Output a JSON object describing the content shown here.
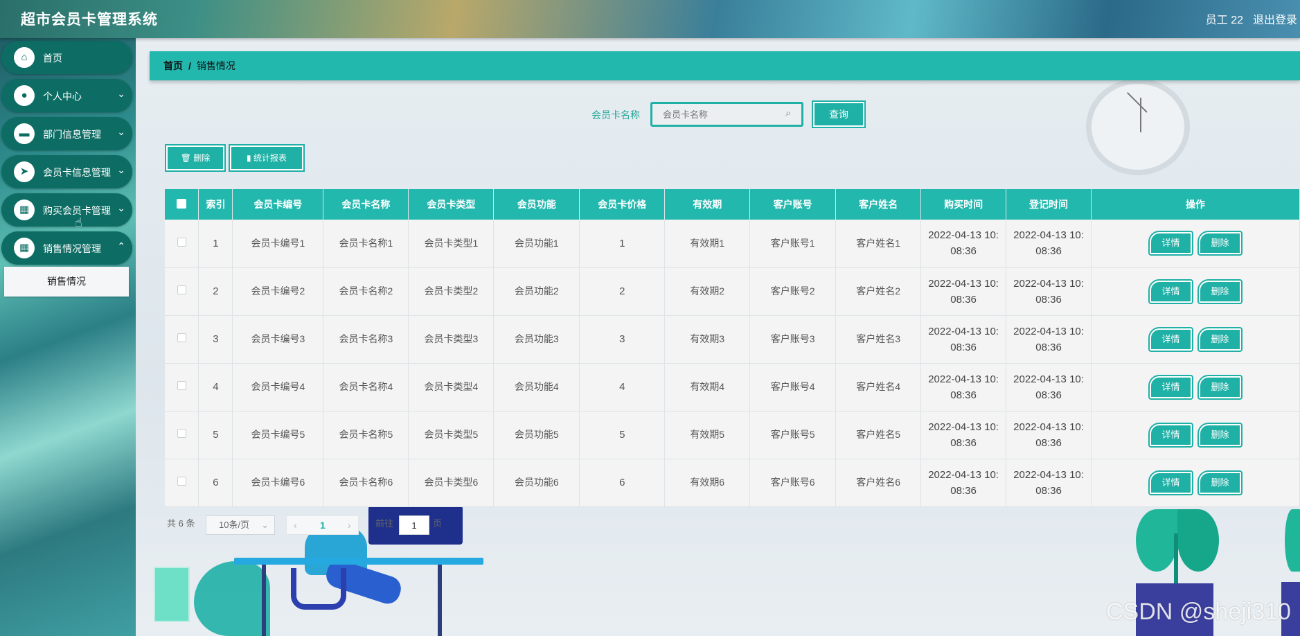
{
  "header": {
    "title": "超市会员卡管理系统",
    "user": "员工 22",
    "logout": "退出登录"
  },
  "sidebar": {
    "items": [
      {
        "label": "首页",
        "icon": "home-icon"
      },
      {
        "label": "个人中心",
        "icon": "user-icon"
      },
      {
        "label": "部门信息管理",
        "icon": "department-icon"
      },
      {
        "label": "会员卡信息管理",
        "icon": "send-icon"
      },
      {
        "label": "购买会员卡管理",
        "icon": "grid-icon"
      },
      {
        "label": "销售情况管理",
        "icon": "grid-icon"
      }
    ],
    "submenu": "销售情况"
  },
  "breadcrumb": {
    "home": "首页",
    "sep": "/",
    "current": "销售情况"
  },
  "search": {
    "label": "会员卡名称",
    "placeholder": "会员卡名称",
    "button": "查询"
  },
  "toolbar": {
    "delete": "删除",
    "report": "统计报表"
  },
  "table": {
    "headers": [
      "索引",
      "会员卡编号",
      "会员卡名称",
      "会员卡类型",
      "会员功能",
      "会员卡价格",
      "有效期",
      "客户账号",
      "客户姓名",
      "购买时间",
      "登记时间",
      "操作"
    ],
    "rows": [
      {
        "idx": "1",
        "no": "会员卡编号1",
        "name": "会员卡名称1",
        "type": "会员卡类型1",
        "func": "会员功能1",
        "price": "1",
        "valid": "有效期1",
        "account": "客户账号1",
        "cname": "客户姓名1",
        "buy_a": "2022-04-13 10:",
        "buy_b": "08:36",
        "reg_a": "2022-04-13 10:",
        "reg_b": "08:36"
      },
      {
        "idx": "2",
        "no": "会员卡编号2",
        "name": "会员卡名称2",
        "type": "会员卡类型2",
        "func": "会员功能2",
        "price": "2",
        "valid": "有效期2",
        "account": "客户账号2",
        "cname": "客户姓名2",
        "buy_a": "2022-04-13 10:",
        "buy_b": "08:36",
        "reg_a": "2022-04-13 10:",
        "reg_b": "08:36"
      },
      {
        "idx": "3",
        "no": "会员卡编号3",
        "name": "会员卡名称3",
        "type": "会员卡类型3",
        "func": "会员功能3",
        "price": "3",
        "valid": "有效期3",
        "account": "客户账号3",
        "cname": "客户姓名3",
        "buy_a": "2022-04-13 10:",
        "buy_b": "08:36",
        "reg_a": "2022-04-13 10:",
        "reg_b": "08:36"
      },
      {
        "idx": "4",
        "no": "会员卡编号4",
        "name": "会员卡名称4",
        "type": "会员卡类型4",
        "func": "会员功能4",
        "price": "4",
        "valid": "有效期4",
        "account": "客户账号4",
        "cname": "客户姓名4",
        "buy_a": "2022-04-13 10:",
        "buy_b": "08:36",
        "reg_a": "2022-04-13 10:",
        "reg_b": "08:36"
      },
      {
        "idx": "5",
        "no": "会员卡编号5",
        "name": "会员卡名称5",
        "type": "会员卡类型5",
        "func": "会员功能5",
        "price": "5",
        "valid": "有效期5",
        "account": "客户账号5",
        "cname": "客户姓名5",
        "buy_a": "2022-04-13 10:",
        "buy_b": "08:36",
        "reg_a": "2022-04-13 10:",
        "reg_b": "08:36"
      },
      {
        "idx": "6",
        "no": "会员卡编号6",
        "name": "会员卡名称6",
        "type": "会员卡类型6",
        "func": "会员功能6",
        "price": "6",
        "valid": "有效期6",
        "account": "客户账号6",
        "cname": "客户姓名6",
        "buy_a": "2022-04-13 10:",
        "buy_b": "08:36",
        "reg_a": "2022-04-13 10:",
        "reg_b": "08:36"
      }
    ],
    "detail": "详情",
    "delete": "删除"
  },
  "pagination": {
    "total": "共 6 条",
    "page_size": "10条/页",
    "current": "1",
    "goto_label": "前往",
    "goto_value": "1",
    "page_suffix": "页"
  },
  "watermark": "CSDN @sheji310",
  "colors": {
    "accent": "#22b8ae",
    "sidebar_item": "#0d6d64"
  }
}
